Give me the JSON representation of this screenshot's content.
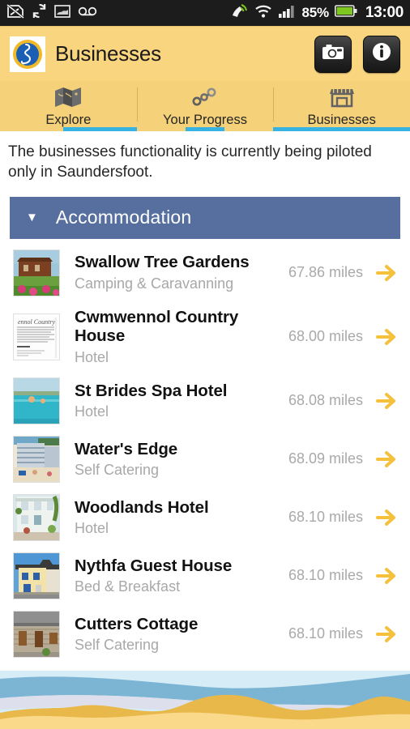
{
  "status_bar": {
    "icons_left": [
      "no-sim-icon",
      "sync-icon",
      "screenshot-icon",
      "voicemail-icon"
    ],
    "icons_right": [
      "gps-satellite-icon",
      "wifi-icon",
      "signal-bars-icon",
      "battery-icon"
    ],
    "battery_percent": "85%",
    "clock": "13:00"
  },
  "header": {
    "logo_name": "wales-coast-path-logo",
    "title": "Businesses",
    "camera_button_label": "camera-icon",
    "info_button_label": "info-icon"
  },
  "tabs": [
    {
      "label": "Explore",
      "icon": "map-icon",
      "active": false
    },
    {
      "label": "Your Progress",
      "icon": "route-icon",
      "active": false
    },
    {
      "label": "Businesses",
      "icon": "storefront-icon",
      "active": true
    }
  ],
  "notice": "The businesses functionality is currently being piloted only in Saundersfoot.",
  "section": {
    "title": "Accommodation",
    "caret": "▼",
    "expanded": true
  },
  "listings": [
    {
      "name": "Swallow Tree Gardens",
      "category": "Camping & Caravanning",
      "distance": "67.86 miles",
      "thumb": "lodge-photo"
    },
    {
      "name": "Cwmwennol Country House",
      "category": "Hotel",
      "distance": "68.00 miles",
      "thumb": "document-photo"
    },
    {
      "name": "St Brides Spa Hotel",
      "category": "Hotel",
      "distance": "68.08 miles",
      "thumb": "pool-photo"
    },
    {
      "name": "Water's Edge",
      "category": "Self Catering",
      "distance": "68.09 miles",
      "thumb": "seafront-building-photo"
    },
    {
      "name": "Woodlands Hotel",
      "category": "Hotel",
      "distance": "68.10 miles",
      "thumb": "white-house-photo"
    },
    {
      "name": "Nythfa Guest House",
      "category": "Bed & Breakfast",
      "distance": "68.10 miles",
      "thumb": "guesthouse-photo"
    },
    {
      "name": "Cutters Cottage",
      "category": "Self Catering",
      "distance": "68.10 miles",
      "thumb": "stone-cottage-photo"
    }
  ],
  "colors": {
    "header_yellow": "#f8d57e",
    "tab_yellow": "#f5d179",
    "tab_active_blue": "#38b2e0",
    "section_blue": "#566f9e",
    "arrow_gold": "#f5c13c",
    "sky": "#d6ecf7",
    "sea": "#7cb4d4",
    "foam": "#dde0ec",
    "sand_dark": "#e8b84b",
    "sand_light": "#fbd98a"
  }
}
